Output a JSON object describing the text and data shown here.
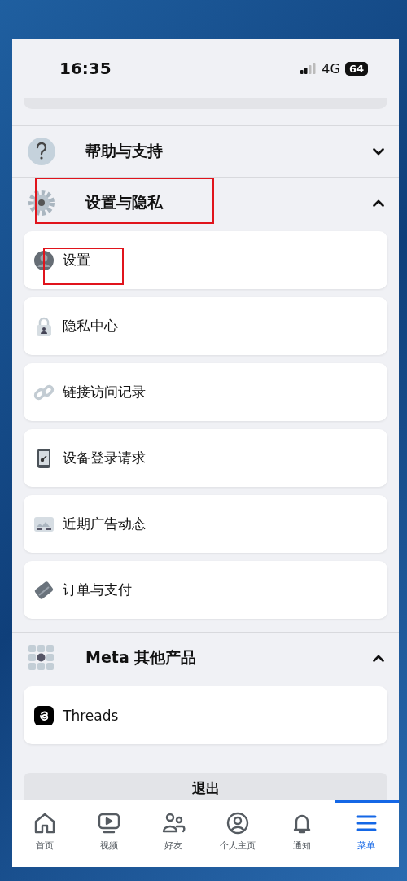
{
  "status_bar": {
    "time": "16:35",
    "network": "4G",
    "battery": "64"
  },
  "sections": [
    {
      "title": "帮助与支持",
      "kind": "help",
      "expanded": false,
      "highlighted": false
    },
    {
      "title": "设置与隐私",
      "kind": "gear",
      "expanded": true,
      "highlighted": true,
      "items": [
        {
          "label": "设置",
          "kind": "avatar",
          "highlighted": true
        },
        {
          "label": "隐私中心",
          "kind": "lock",
          "highlighted": false
        },
        {
          "label": "链接访问记录",
          "kind": "link",
          "highlighted": false
        },
        {
          "label": "设备登录请求",
          "kind": "phone",
          "highlighted": false
        },
        {
          "label": "近期广告动态",
          "kind": "ads",
          "highlighted": false
        },
        {
          "label": "订单与支付",
          "kind": "card",
          "highlighted": false
        }
      ]
    },
    {
      "title": "Meta 其他产品",
      "kind": "grid",
      "expanded": true,
      "highlighted": false,
      "items": [
        {
          "label": "Threads",
          "kind": "threads",
          "highlighted": false
        }
      ]
    }
  ],
  "logout_button": "退出",
  "tabs": [
    {
      "label": "首页",
      "kind": "home",
      "selected": false
    },
    {
      "label": "视频",
      "kind": "video",
      "selected": false
    },
    {
      "label": "好友",
      "kind": "friends",
      "selected": false
    },
    {
      "label": "个人主页",
      "kind": "profile",
      "selected": false
    },
    {
      "label": "通知",
      "kind": "bell",
      "selected": false
    },
    {
      "label": "菜单",
      "kind": "menu",
      "selected": true
    }
  ]
}
